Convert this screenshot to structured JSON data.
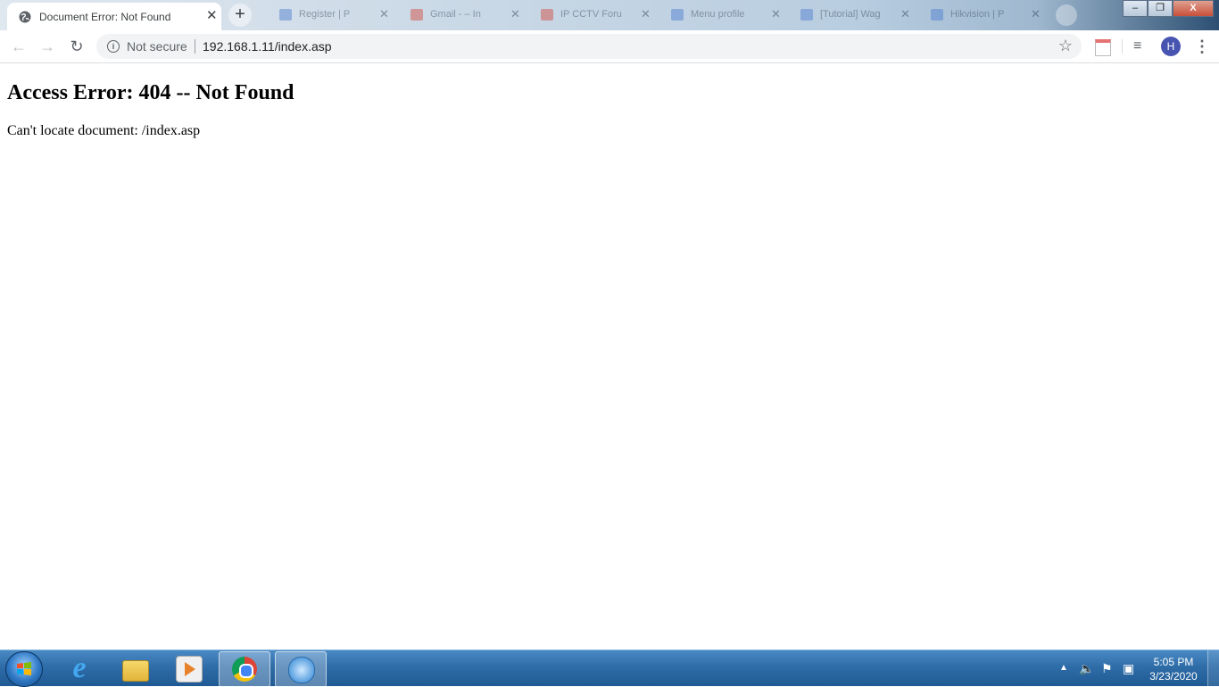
{
  "browser": {
    "active_tab": {
      "title": "Document Error: Not Found",
      "favicon": "globe-icon",
      "close_glyph": "✕"
    },
    "new_tab_glyph": "+",
    "background_tabs": [
      {
        "title": "Register | P",
        "favicon": "page-icon",
        "color": "#4a7bd0"
      },
      {
        "title": "Gmail - – In",
        "favicon": "gmail-icon",
        "color": "#d44638"
      },
      {
        "title": "IP CCTV Foru",
        "favicon": "gmail-icon",
        "color": "#d44638"
      },
      {
        "title": "Menu profile",
        "favicon": "page-icon",
        "color": "#4a7bd0"
      },
      {
        "title": "[Tutorial] Wag",
        "favicon": "page-icon",
        "color": "#4a7bd0"
      },
      {
        "title": "Hikvision | P",
        "favicon": "page-icon",
        "color": "#4a7bd0"
      }
    ],
    "window_controls": {
      "minimize": "–",
      "restore": "❐",
      "close": "X"
    },
    "toolbar": {
      "back_glyph": "←",
      "forward_glyph": "→",
      "reload_glyph": "↻",
      "security_label": "Not secure",
      "url": "192.168.1.11/index.asp",
      "star_glyph": "☆",
      "media_glyph": "≡",
      "avatar_initial": "H",
      "menu_glyph": "⋮"
    }
  },
  "page": {
    "heading": "Access Error: 404 -- Not Found",
    "message": "Can't locate document: /index.asp"
  },
  "taskbar": {
    "items": [
      {
        "name": "internet-explorer-icon",
        "active": false
      },
      {
        "name": "file-explorer-icon",
        "active": false
      },
      {
        "name": "media-player-icon",
        "active": false
      },
      {
        "name": "chrome-icon",
        "active": true
      },
      {
        "name": "network-search-icon",
        "active": true
      }
    ],
    "tray": {
      "show_hidden_glyph": "▲",
      "volume_glyph": "🔈",
      "flag_glyph": "⚑",
      "network_glyph": "▣"
    },
    "clock": {
      "time": "5:05 PM",
      "date": "3/23/2020"
    }
  }
}
